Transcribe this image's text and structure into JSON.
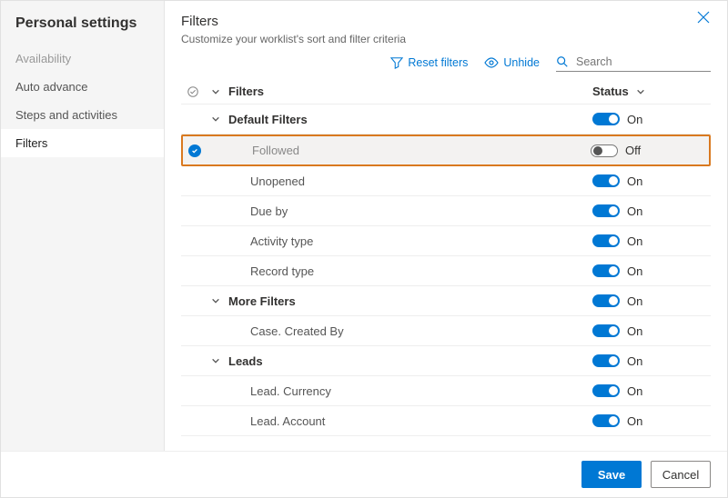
{
  "sidebar": {
    "title": "Personal settings",
    "items": [
      {
        "label": "Availability",
        "dim": true
      },
      {
        "label": "Auto advance"
      },
      {
        "label": "Steps and activities"
      },
      {
        "label": "Filters",
        "active": true
      }
    ]
  },
  "header": {
    "title": "Filters",
    "subtitle": "Customize your worklist's sort and filter criteria"
  },
  "toolbar": {
    "reset": "Reset filters",
    "unhide": "Unhide",
    "searchPlaceholder": "Search"
  },
  "columns": {
    "name": "Filters",
    "status": "Status"
  },
  "status": {
    "on": "On",
    "off": "Off"
  },
  "rows": [
    {
      "type": "group",
      "label": "Default Filters",
      "on": true
    },
    {
      "type": "child-highlight",
      "label": "Followed",
      "on": false
    },
    {
      "type": "child",
      "label": "Unopened",
      "on": true
    },
    {
      "type": "child",
      "label": "Due by",
      "on": true
    },
    {
      "type": "child",
      "label": "Activity type",
      "on": true
    },
    {
      "type": "child",
      "label": "Record type",
      "on": true
    },
    {
      "type": "group",
      "label": "More Filters",
      "on": true
    },
    {
      "type": "child",
      "label": "Case. Created By",
      "on": true
    },
    {
      "type": "group",
      "label": "Leads",
      "on": true
    },
    {
      "type": "child",
      "label": "Lead. Currency",
      "on": true
    },
    {
      "type": "child",
      "label": "Lead. Account",
      "on": true
    }
  ],
  "footer": {
    "save": "Save",
    "cancel": "Cancel"
  }
}
